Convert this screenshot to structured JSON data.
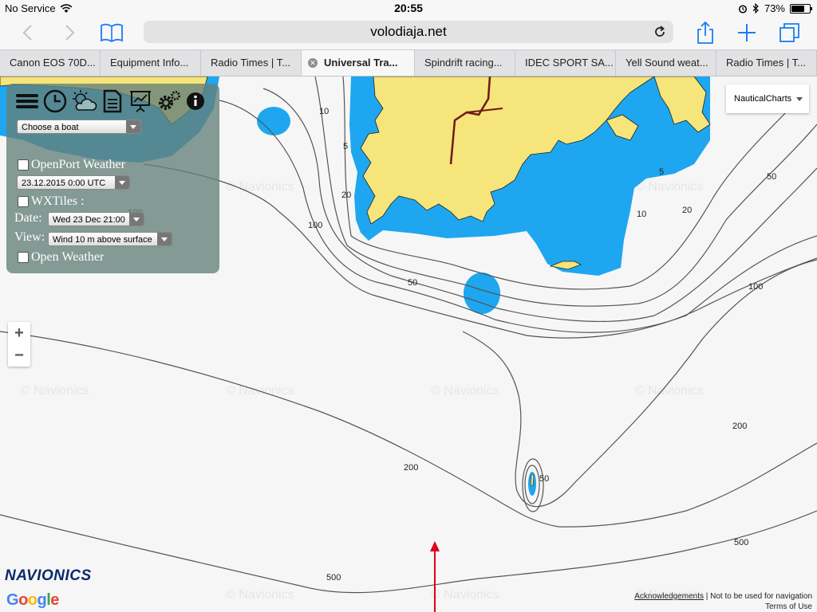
{
  "status": {
    "carrier": "No Service",
    "time": "20:55",
    "battery_text": "73%",
    "battery_level": 0.73
  },
  "toolbar": {
    "url": "volodiaja.net"
  },
  "tabs": [
    {
      "label": "Canon EOS 70D...",
      "active": false
    },
    {
      "label": "Equipment Info...",
      "active": false
    },
    {
      "label": "Radio Times | T...",
      "active": false
    },
    {
      "label": "Universal Tra...",
      "active": true
    },
    {
      "label": "Spindrift racing...",
      "active": false
    },
    {
      "label": "IDEC SPORT SA...",
      "active": false
    },
    {
      "label": "Yell Sound weat...",
      "active": false
    },
    {
      "label": "Radio Times | T...",
      "active": false
    }
  ],
  "panel": {
    "boat_select": "Choose a boat",
    "openport_label": "OpenPort Weather",
    "openport_date": "23.12.2015 0:00 UTC",
    "wxtiles_label": "WXTiles :",
    "date_label": "Date:",
    "date_value": "Wed 23 Dec 21:00",
    "view_label": "View:",
    "view_value": "Wind 10 m above surface",
    "open_weather_label": "Open Weather"
  },
  "zoom": {
    "plus": "+",
    "minus": "−"
  },
  "map_type": "NauticalCharts",
  "depth_labels": {
    "d10a": "10",
    "d5a": "5",
    "d20a": "20",
    "d100a": "100",
    "d50a": "50",
    "d5b": "5",
    "d10b": "10",
    "d20b": "20",
    "d50b": "50",
    "d100b": "100",
    "d200a": "200",
    "d200b": "200",
    "d50c": "50",
    "d500a": "500",
    "d500b": "500",
    "d100c": "100"
  },
  "watermark": "© Navionics",
  "logos": {
    "navionics": "NAVIONICS",
    "google": "Google"
  },
  "footer": {
    "acknowledgements": "Acknowledgements",
    "nav_note": " | Not to be used for navigation",
    "terms": "Terms of Use"
  },
  "colors": {
    "land": "#f5e57a",
    "shallow": "#1ea7f0",
    "sea": "#f6f6f6",
    "contour": "#555555",
    "track": "#e0001a"
  },
  "icons": {
    "back": "chevron-left-icon",
    "forward": "chevron-right-icon",
    "bookmarks": "book-icon",
    "share": "share-icon",
    "new_tab": "plus-icon",
    "tabs": "tabs-icon"
  }
}
